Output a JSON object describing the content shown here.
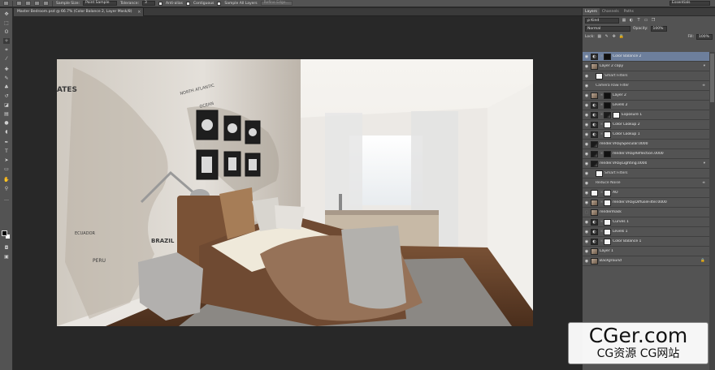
{
  "options_bar": {
    "sample_size_label": "Sample Size:",
    "sample_size_value": "Point Sample",
    "tolerance_label": "Tolerance:",
    "tolerance_value": "3",
    "anti_alias_label": "Anti-alias",
    "contiguous_label": "Contiguous",
    "sample_all_layers_label": "Sample All Layers",
    "refine_edge_label": "Refine Edge...",
    "workspace_value": "Essentials"
  },
  "document": {
    "tab_title": "Master Bedroom.psd @ 66.7% (Color Balance 2, Layer Mask/8)",
    "close_glyph": "×"
  },
  "artwork": {
    "map_labels": {
      "states": "ATES",
      "north_atlantic": "NORTH ATLANTIC",
      "ocean": "OCEAN",
      "ecuador": "ECUADOR",
      "peru": "PERU",
      "brazil": "BRAZIL"
    }
  },
  "layers_panel": {
    "tabs": [
      "Layers",
      "Channels",
      "Paths"
    ],
    "filter_kind": "ρ Kind",
    "blend_mode": "Normal",
    "opacity_label": "Opacity:",
    "opacity_value": "100%",
    "lock_label": "Lock:",
    "fill_label": "Fill:",
    "fill_value": "100%",
    "layers": [
      "Color Balance 2",
      "Layer 2 copy",
      "Smart Filters",
      "Camera Raw Filter",
      "Layer 2",
      "Levels 2",
      "Exposure 1",
      "Color Lookup 2",
      "Color Lookup 1",
      "render.VRaySpecular.0000",
      "render.VRayReflection.0000",
      "render.VRayLighting.0000",
      "Smart Filters",
      "Reduce Noise",
      "AO",
      "render.VRayDiffuseFilter.0000",
      "rendermask",
      "Curves 1",
      "Levels 1",
      "Color Balance 1",
      "Layer 1",
      "Background"
    ]
  },
  "watermark": {
    "title": "CGer.com",
    "subtitle": "CG资源 CG网站"
  },
  "colors": {
    "ui_dark": "#282828",
    "panel": "#535353",
    "selected_layer": "#6d7f9c"
  }
}
